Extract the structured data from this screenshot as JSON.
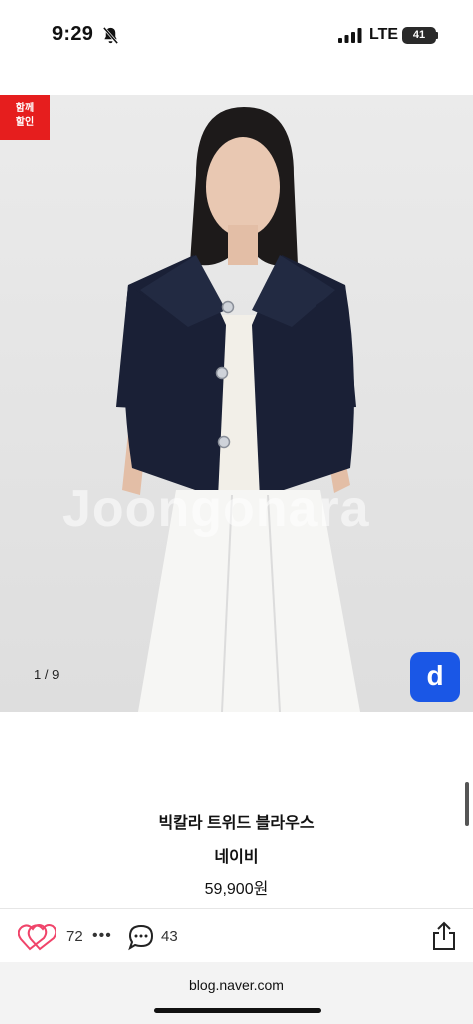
{
  "status_bar": {
    "time": "9:29",
    "network": "LTE",
    "battery": "41"
  },
  "image": {
    "badge_line1": "함께",
    "badge_line2": "할인",
    "watermark": "Joongonara",
    "counter": "1 / 9",
    "d_button_label": "d"
  },
  "product": {
    "name": "빅칼라 트위드 블라우스",
    "option": "네이비",
    "price": "59,900원"
  },
  "actions": {
    "likes": "72",
    "comments": "43"
  },
  "browser": {
    "url": "blog.naver.com"
  },
  "colors": {
    "accent_red": "#e61e1e",
    "d_button_blue": "#1a57e6",
    "heart_pink": "#f0446a"
  }
}
